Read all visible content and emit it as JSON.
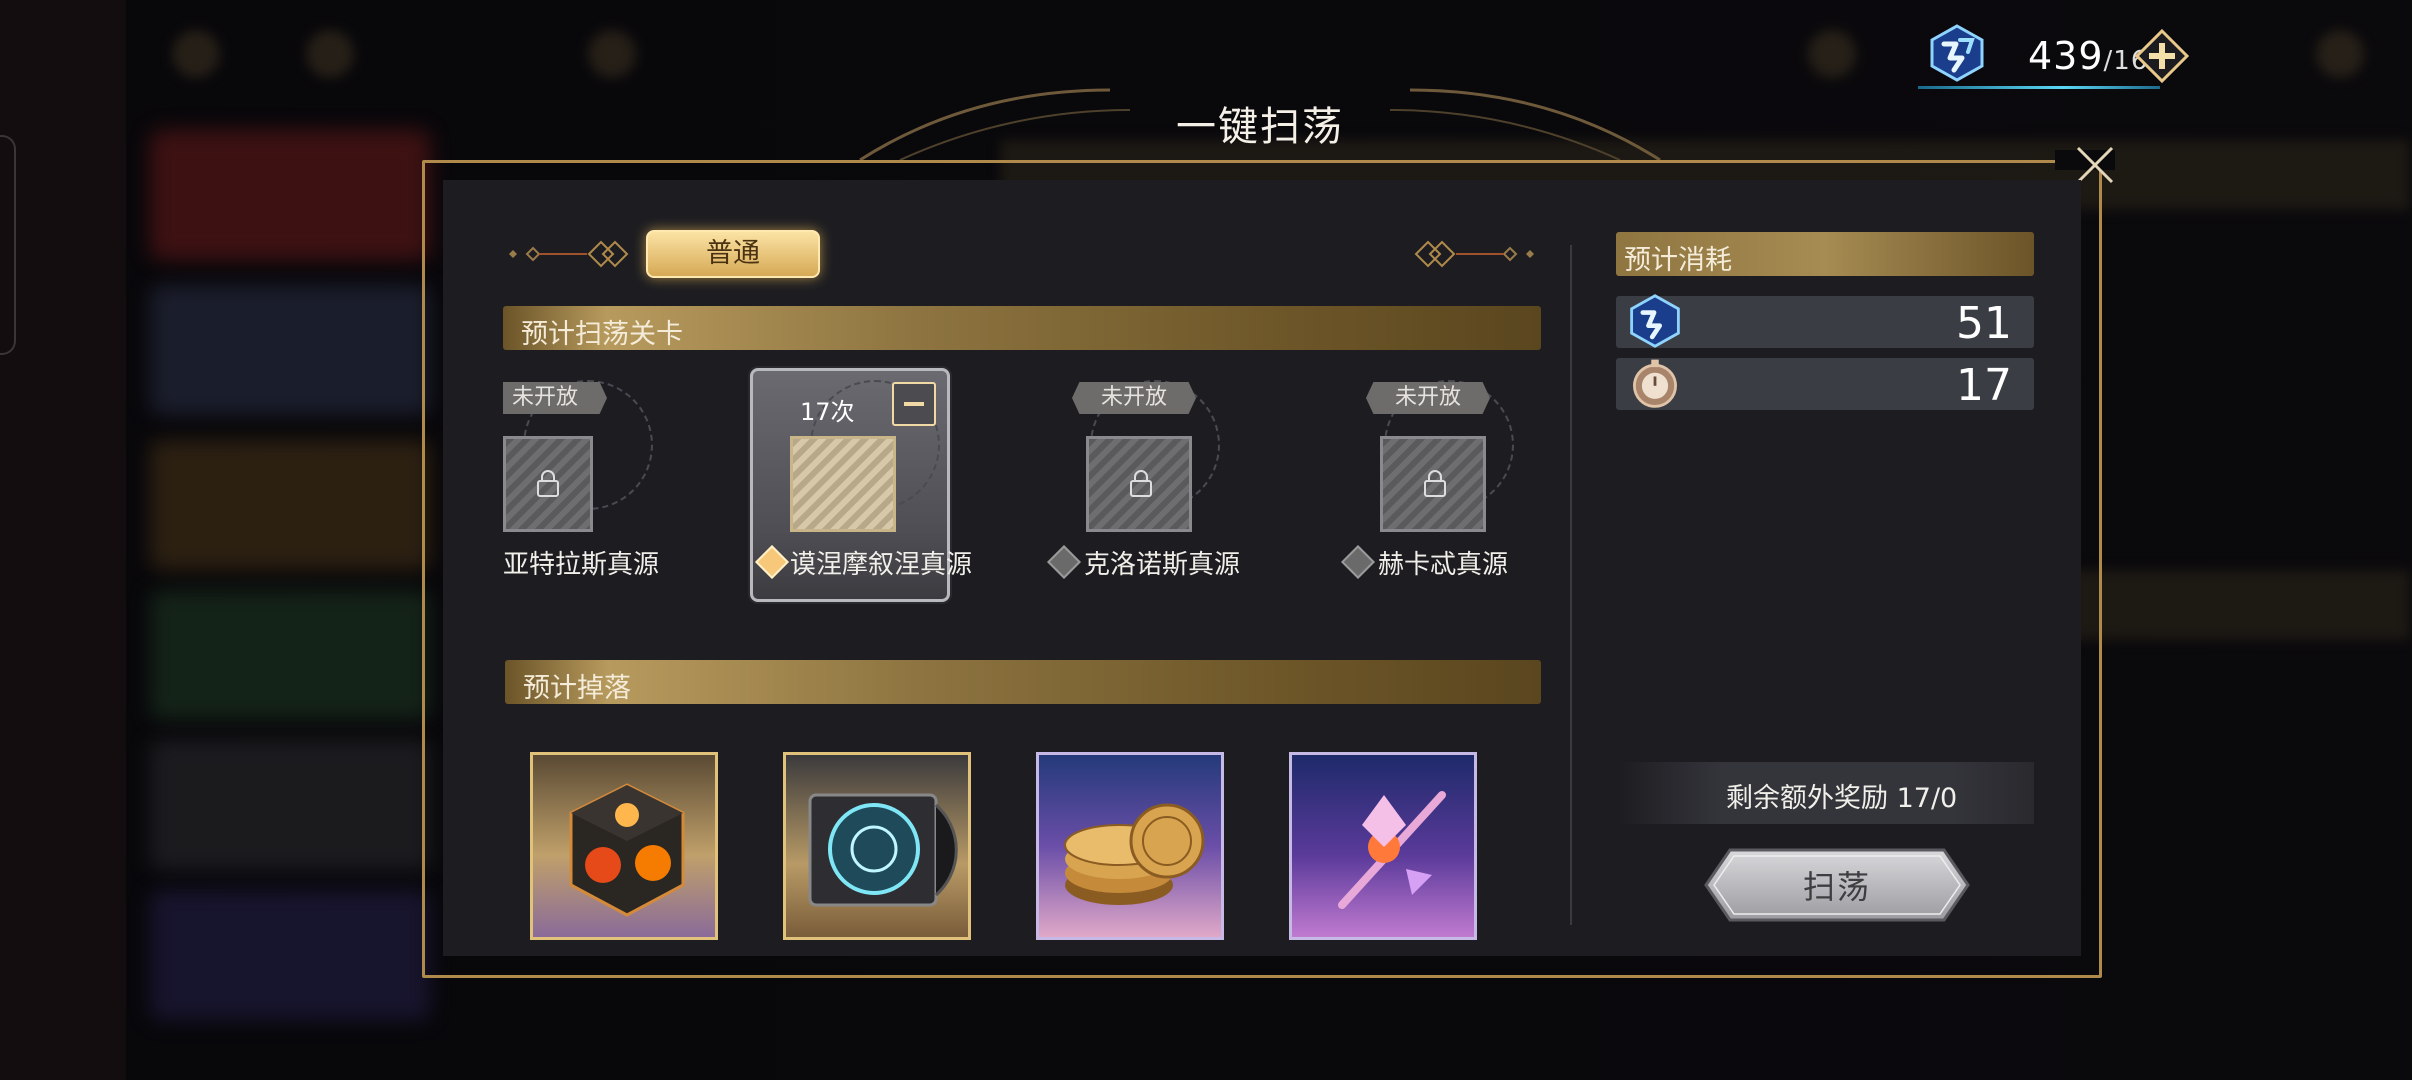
{
  "header": {
    "energy_value": "439",
    "energy_max": "/16"
  },
  "dialog": {
    "title": "一键扫荡",
    "tab_label": "普通",
    "stages_header": "预计扫荡关卡",
    "drops_header": "预计掉落",
    "stages": [
      {
        "name": "亚特拉斯真源",
        "status": "未开放",
        "locked": true
      },
      {
        "name": "谟涅摩叙涅真源",
        "status": "17次",
        "locked": false,
        "selected": true
      },
      {
        "name": "克洛诺斯真源",
        "status": "未开放",
        "locked": true
      },
      {
        "name": "赫卡忒真源",
        "status": "未开放",
        "locked": true
      }
    ],
    "drops": [
      {
        "icon": "fire-cube-icon",
        "frame": "gold"
      },
      {
        "icon": "compass-disc-icon",
        "frame": "gold"
      },
      {
        "icon": "gold-coins-icon",
        "frame": "purple"
      },
      {
        "icon": "crystal-staff-icon",
        "frame": "purple"
      }
    ],
    "cost": {
      "header": "预计消耗",
      "items": [
        {
          "icon": "energy-icon",
          "value": "51"
        },
        {
          "icon": "stopwatch-icon",
          "value": "17"
        }
      ]
    },
    "extra_reward": "剩余额外奖励  17/0",
    "sweep_label": "扫荡"
  },
  "colors": {
    "gold_accent": "#b08a4a",
    "energy_cyan": "#5ad8f5",
    "tab_gold": "#d6a955"
  }
}
